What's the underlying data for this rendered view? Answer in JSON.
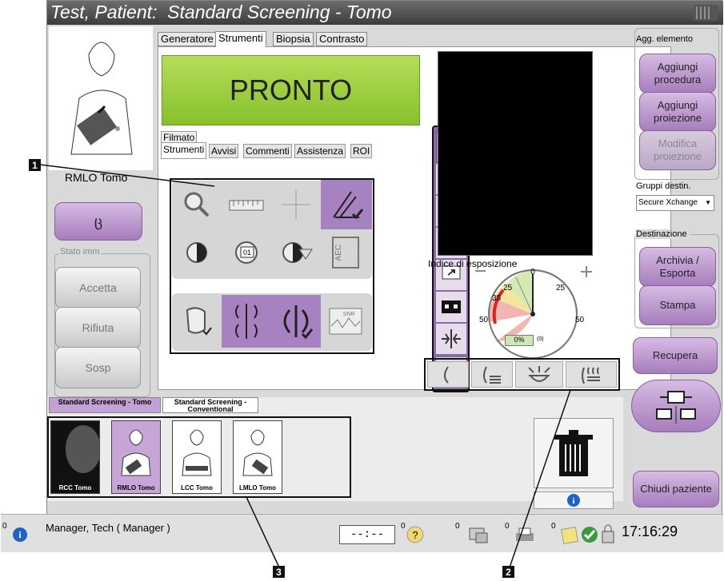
{
  "window": {
    "title": "Test, Patient:  Standard Screening - Tomo"
  },
  "left": {
    "procedure_view_label": "RMLO Tomo",
    "image_status_label": "Stato imm",
    "accept": "Accetta",
    "reject": "Rifiuta",
    "pend": "Sosp"
  },
  "tabs": [
    "Generatore",
    "Strumenti",
    "Biopsia",
    "Contrasto"
  ],
  "ready_text": "PRONTO",
  "filmato_label": "Filmato",
  "subtabs": [
    "Strumenti",
    "Avvisi",
    "Commenti",
    "Assistenza",
    "ROI"
  ],
  "tools": {
    "wl_badge": "01",
    "aec": "AEC",
    "snr": "SNR"
  },
  "exposure": {
    "label": "Indice di esposizione",
    "scale": [
      "0",
      "25",
      "25",
      "35",
      "50",
      "50"
    ],
    "value": "0%",
    "count": "(0)"
  },
  "right": {
    "add_element_label": "Agg. elemento",
    "add_procedure": "Aggiungi procedura",
    "add_view": "Aggiungi proiezione",
    "edit_view": "Modifica proiezione",
    "dest_groups_label": "Gruppi destin.",
    "dest_group_value": "Secure Xchange",
    "destination_label": "Destinazione",
    "archive_export": "Archivia / Esporta",
    "print": "Stampa",
    "retrieve": "Recupera",
    "close_patient": "Chiudi paziente"
  },
  "procedure_tabs": [
    "Standard Screening - Tomo",
    "Standard Screening - Conventional"
  ],
  "thumbnails": [
    "RCC Tomo",
    "RMLO Tomo",
    "LCC Tomo",
    "LMLO Tomo"
  ],
  "status": {
    "user": "Manager, Tech ( Manager )",
    "timer": "--:--",
    "counts": [
      "0",
      "0",
      "0",
      "0",
      "0"
    ],
    "clock": "17:16:29"
  },
  "callouts": [
    "1",
    "2",
    "3"
  ],
  "colors": {
    "ready": "#9ccc3c",
    "purple": "#a782c0",
    "titlebar": "#4a4a4a"
  }
}
